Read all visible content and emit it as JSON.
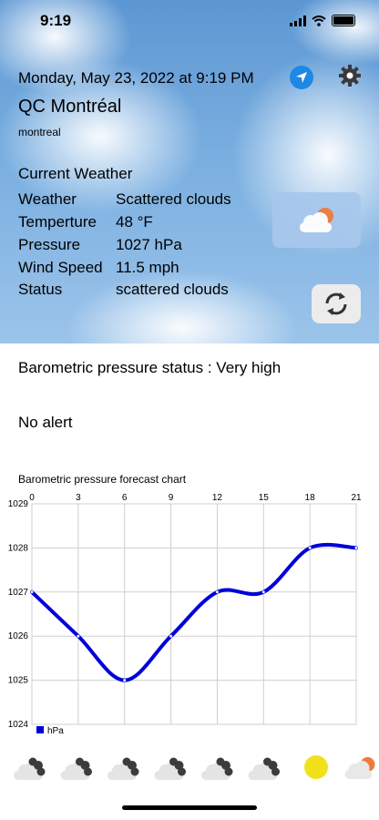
{
  "status_bar": {
    "time": "9:19"
  },
  "header": {
    "date": "Monday, May 23, 2022 at 9:19 PM",
    "city": "QC Montréal",
    "subtitle": "montreal"
  },
  "current": {
    "heading": "Current Weather",
    "rows": [
      {
        "label": "Weather",
        "value": "Scattered clouds"
      },
      {
        "label": "Temperture",
        "value": "48 °F"
      },
      {
        "label": "Pressure",
        "value": "1027 hPa"
      },
      {
        "label": "Wind Speed",
        "value": "11.5 mph"
      },
      {
        "label": "Status",
        "value": "scattered clouds"
      }
    ],
    "icon": "partly-cloudy-night-icon"
  },
  "pressure_status": "Barometric pressure status : Very high",
  "alert": "No alert",
  "chart_title": "Barometric pressure forecast chart",
  "colors": {
    "accent": "#1e88e5",
    "series": "#0000d8",
    "sun": "#f2e11a",
    "moon": "#f07a3c"
  },
  "chart_data": {
    "type": "line",
    "x": [
      0,
      3,
      6,
      9,
      12,
      15,
      18,
      21
    ],
    "x_ticks": [
      "0",
      "3",
      "6",
      "9",
      "12",
      "15",
      "18",
      "21"
    ],
    "y_ticks": [
      "1029",
      "1028",
      "1027",
      "1026",
      "1025",
      "1024"
    ],
    "ylim": [
      1024,
      1029
    ],
    "xlim": [
      0,
      21
    ],
    "grid": true,
    "legend_position": "bottom-left",
    "series": [
      {
        "name": "hPa",
        "values": [
          1027,
          1026,
          1025,
          1026,
          1027,
          1027,
          1028,
          1028
        ]
      }
    ]
  },
  "forecast_icons": [
    "cloudy-icon",
    "cloudy-icon",
    "cloudy-icon",
    "cloudy-icon",
    "cloudy-icon",
    "cloudy-icon",
    "sun-icon",
    "partly-cloudy-icon"
  ]
}
